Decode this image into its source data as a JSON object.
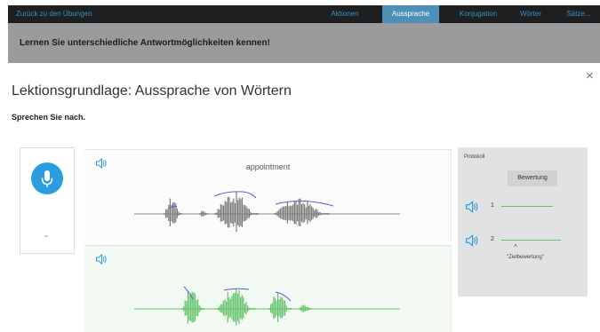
{
  "nav": {
    "back_label": "Zurück zu den Übungen",
    "tabs": [
      {
        "label": "Aktionen",
        "active": false
      },
      {
        "label": "Aussprache",
        "active": true
      },
      {
        "label": "Konjugation",
        "active": false
      },
      {
        "label": "Wörter",
        "active": false
      },
      {
        "label": "Sätze...",
        "active": false
      }
    ]
  },
  "banner": {
    "text": "Lernen Sie unterschiedliche Antwortmöglichkeiten kennen!"
  },
  "dialog": {
    "close_icon": "×",
    "title": "Lektionsgrundlage: Aussprache von Wörtern",
    "instruction": "Sprechen Sie nach."
  },
  "recorder": {
    "mic_icon": "microphone-icon",
    "expand_icon": "⌄"
  },
  "waveforms": {
    "reference_word": "appointment",
    "reference_color": "#7a7a7a",
    "recording_color": "#63c46a",
    "pitch_color": "#5a5fd0"
  },
  "protocol": {
    "title": "Protokoll",
    "rating_header": "Bewertung",
    "attempts": [
      {
        "number": "1"
      },
      {
        "number": "2"
      }
    ],
    "target_caret": "^",
    "target_label": "\"Zielbewertung\""
  },
  "colors": {
    "accent": "#2a9de0",
    "nav_bg": "#1d1f20",
    "nav_active": "#4e8fb8",
    "banner_bg": "#999b9d",
    "protocol_bg": "#e1e2e3",
    "rating_line": "#5fc560"
  }
}
